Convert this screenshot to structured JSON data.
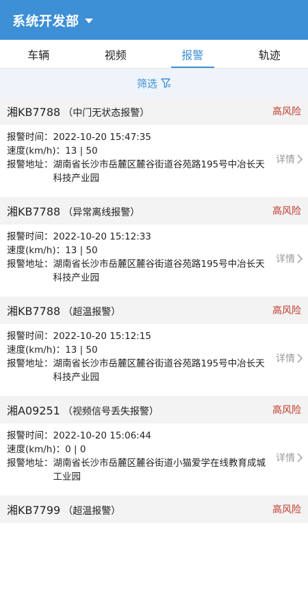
{
  "header": {
    "title": "系统开发部"
  },
  "tabs": [
    {
      "label": "车辆",
      "active": false
    },
    {
      "label": "视频",
      "active": false
    },
    {
      "label": "报警",
      "active": true
    },
    {
      "label": "轨迹",
      "active": false
    }
  ],
  "filter": {
    "label": "筛选"
  },
  "labels": {
    "time": "报警时间：",
    "speed": "速度(km/h)：",
    "address": "报警地址：",
    "detail": "详情"
  },
  "alarms": [
    {
      "plate": "湘KB7788",
      "type": "（中门无状态报警）",
      "risk": "高风险",
      "time": "2022-10-20 15:47:35",
      "speed": "13 | 50",
      "address": "湖南省长沙市岳麓区麓谷街道谷苑路195号中冶长天科技产业园"
    },
    {
      "plate": "湘KB7788",
      "type": "（异常离线报警）",
      "risk": "高风险",
      "time": "2022-10-20 15:12:33",
      "speed": "13 | 50",
      "address": "湖南省长沙市岳麓区麓谷街道谷苑路195号中冶长天科技产业园"
    },
    {
      "plate": "湘KB7788",
      "type": "（超温报警）",
      "risk": "高风险",
      "time": "2022-10-20 15:12:15",
      "speed": "13 | 50",
      "address": "湖南省长沙市岳麓区麓谷街道谷苑路195号中冶长天科技产业园"
    },
    {
      "plate": "湘A09251",
      "type": "（视频信号丢失报警）",
      "risk": "高风险",
      "time": "2022-10-20 15:06:44",
      "speed": "0 | 0",
      "address": "湖南省长沙市岳麓区麓谷街道小猫爱学在线教育成城工业园"
    },
    {
      "plate": "湘KB7799",
      "type": "（超温报警）",
      "risk": "高风险"
    }
  ],
  "colors": {
    "primary": "#3d8fd6",
    "risk": "#c0392b"
  },
  "icons": {
    "dropdown": "caret-down-icon",
    "filter": "funnel-icon",
    "detail": "chevron-right-icon"
  }
}
